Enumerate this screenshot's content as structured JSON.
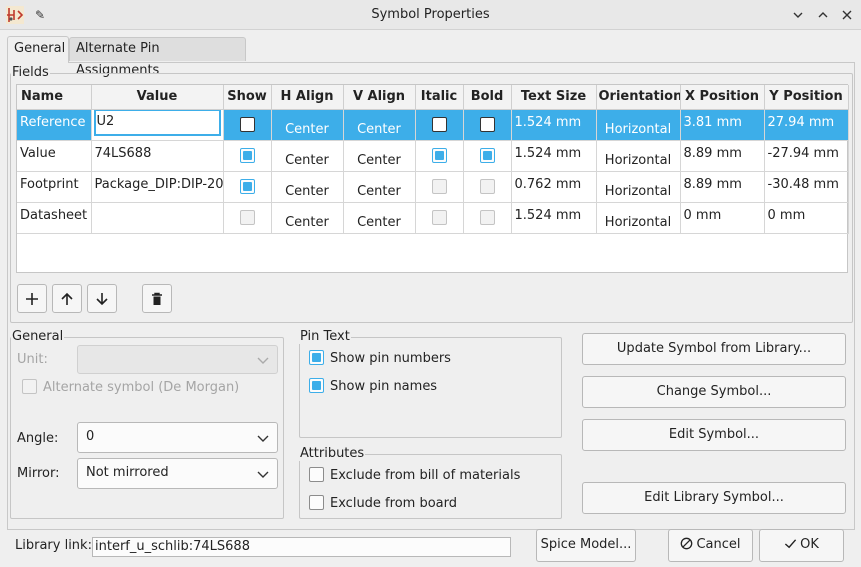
{
  "window": {
    "title": "Symbol Properties"
  },
  "tabs": [
    {
      "label": "General"
    },
    {
      "label": "Alternate Pin Assignments"
    }
  ],
  "fields": {
    "group_label": "Fields",
    "columns": [
      "Name",
      "Value",
      "Show",
      "H Align",
      "V Align",
      "Italic",
      "Bold",
      "Text Size",
      "Orientation",
      "X Position",
      "Y Position"
    ],
    "rows": [
      {
        "name": "Reference",
        "value": "U2",
        "show": false,
        "h_align": "Center",
        "v_align": "Center",
        "italic": false,
        "bold": false,
        "text_size": "1.524 mm",
        "orientation": "Horizontal",
        "x": "3.81 mm",
        "y": "27.94 mm"
      },
      {
        "name": "Value",
        "value": "74LS688",
        "show": true,
        "h_align": "Center",
        "v_align": "Center",
        "italic": true,
        "bold": true,
        "text_size": "1.524 mm",
        "orientation": "Horizontal",
        "x": "8.89 mm",
        "y": "-27.94 mm"
      },
      {
        "name": "Footprint",
        "value": "Package_DIP:DIP-20",
        "show": true,
        "h_align": "Center",
        "v_align": "Center",
        "italic": false,
        "bold": false,
        "text_size": "0.762 mm",
        "orientation": "Horizontal",
        "x": "8.89 mm",
        "y": "-30.48 mm"
      },
      {
        "name": "Datasheet",
        "value": "",
        "show": false,
        "h_align": "Center",
        "v_align": "Center",
        "italic": false,
        "bold": false,
        "text_size": "1.524 mm",
        "orientation": "Horizontal",
        "x": "0 mm",
        "y": "0 mm"
      }
    ]
  },
  "general": {
    "group_label": "General",
    "unit_label": "Unit:",
    "unit_value": "",
    "alternate_symbol_label": "Alternate symbol (De Morgan)",
    "angle_label": "Angle:",
    "angle_value": "0",
    "mirror_label": "Mirror:",
    "mirror_value": "Not mirrored"
  },
  "pin_text": {
    "group_label": "Pin Text",
    "show_pin_numbers": "Show pin numbers",
    "show_pin_names": "Show pin names"
  },
  "attributes": {
    "group_label": "Attributes",
    "exclude_bom": "Exclude from bill of materials",
    "exclude_board": "Exclude from board"
  },
  "actions": {
    "update_symbol": "Update Symbol from Library...",
    "change_symbol": "Change Symbol...",
    "edit_symbol": "Edit Symbol...",
    "edit_library_symbol": "Edit Library Symbol..."
  },
  "footer": {
    "library_link_label": "Library link:",
    "library_link_value": "interf_u_schlib:74LS688",
    "spice_model": "Spice Model...",
    "cancel": "Cancel",
    "ok": "OK"
  },
  "colors": {
    "accent": "#3daee9",
    "window_bg": "#efefef"
  },
  "icons": [
    "kicad-app-icon",
    "pin-icon",
    "chevron-down-icon",
    "chevron-up-icon",
    "close-icon",
    "plus-icon",
    "arrow-up-icon",
    "arrow-down-icon",
    "trash-icon",
    "cancel-icon",
    "check-icon"
  ]
}
